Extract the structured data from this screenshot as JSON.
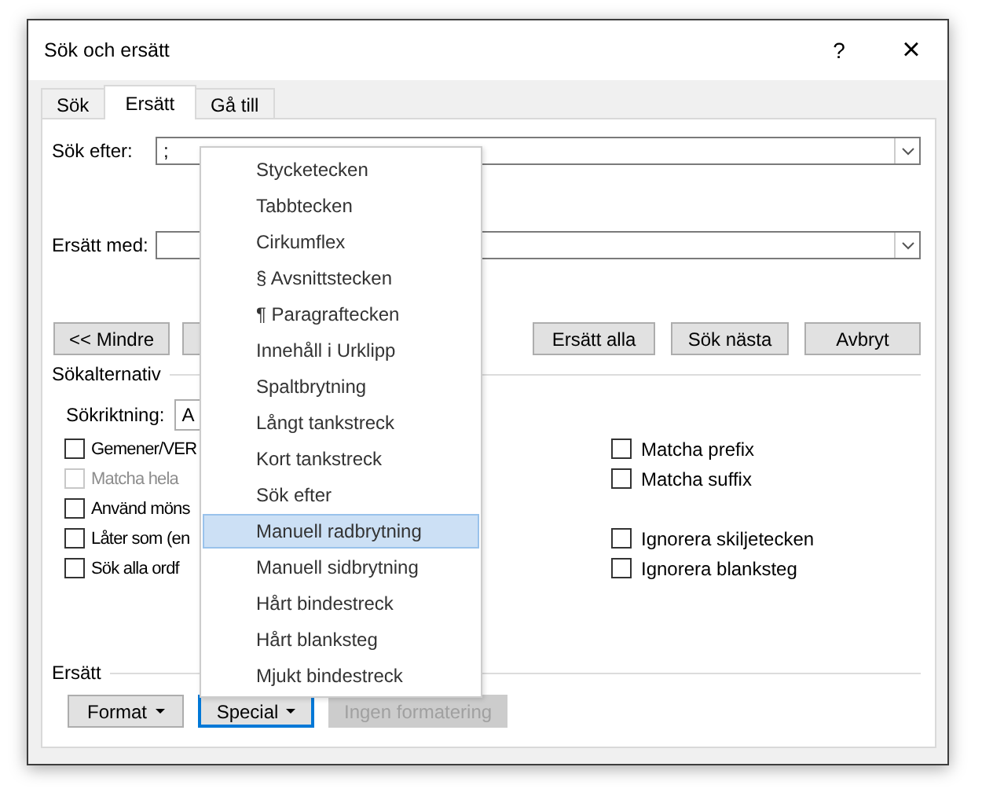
{
  "window": {
    "title": "Sök och ersätt",
    "help": "?",
    "close": "×"
  },
  "tabs": [
    {
      "label": "Sök",
      "selected": false
    },
    {
      "label": "Ersätt",
      "selected": true
    },
    {
      "label": "Gå till",
      "selected": false
    }
  ],
  "find": {
    "label": "Sök efter:",
    "value": ";"
  },
  "replace": {
    "label": "Ersätt med:"
  },
  "buttons": [
    {
      "kind": "text",
      "label": "<< Mindre"
    },
    {
      "kind": "covered"
    },
    {
      "kind": "text",
      "label": "Ersätt alla"
    },
    {
      "kind": "text",
      "label": "Sök nästa"
    },
    {
      "kind": "text",
      "label": "Avbryt"
    }
  ],
  "search_options": {
    "title": "Sökalternativ",
    "direction": {
      "label": "Sökriktning:",
      "value": "A"
    },
    "left_options": [
      {
        "label": "Gemener/VER",
        "checked": false,
        "disabled": false
      },
      {
        "label": "Matcha hela",
        "checked": false,
        "disabled": true
      },
      {
        "label": "Använd möns",
        "checked": false,
        "disabled": false
      },
      {
        "label": "Låter som (en",
        "checked": false,
        "disabled": false
      },
      {
        "label": "Sök alla ordf",
        "checked": false,
        "disabled": false
      }
    ],
    "right_groups": [
      [
        {
          "label": "Matcha prefix",
          "checked": false,
          "disabled": false
        },
        {
          "label": "Matcha suffix",
          "checked": false,
          "disabled": false
        }
      ],
      [
        {
          "label": "Ignorera skiljetecken",
          "checked": false,
          "disabled": false
        },
        {
          "label": "Ignorera blanksteg",
          "checked": false,
          "disabled": false
        }
      ]
    ]
  },
  "replace_section": {
    "title": "Ersätt",
    "buttons": [
      {
        "label": "Format",
        "dropdown": true,
        "focused": false,
        "disabled": false
      },
      {
        "label": "Special",
        "dropdown": true,
        "focused": true,
        "disabled": false
      },
      {
        "label": "Ingen formatering",
        "dropdown": false,
        "focused": false,
        "disabled": true
      }
    ]
  },
  "special_menu": {
    "items": [
      {
        "label": "Stycketecken",
        "selected": false
      },
      {
        "label": "Tabbtecken",
        "selected": false
      },
      {
        "label": "Cirkumflex",
        "selected": false
      },
      {
        "label": "§ Avsnittstecken",
        "selected": false
      },
      {
        "label": "¶ Paragraftecken",
        "selected": false
      },
      {
        "label": "Innehåll i Urklipp",
        "selected": false
      },
      {
        "label": "Spaltbrytning",
        "selected": false
      },
      {
        "label": "Långt tankstreck",
        "selected": false
      },
      {
        "label": "Kort tankstreck",
        "selected": false
      },
      {
        "label": "Sök efter",
        "selected": false
      },
      {
        "label": "Manuell radbrytning",
        "selected": true
      },
      {
        "label": "Manuell sidbrytning",
        "selected": false
      },
      {
        "label": "Hårt bindestreck",
        "selected": false
      },
      {
        "label": "Hårt blanksteg",
        "selected": false
      },
      {
        "label": "Mjukt bindestreck",
        "selected": false
      }
    ]
  }
}
